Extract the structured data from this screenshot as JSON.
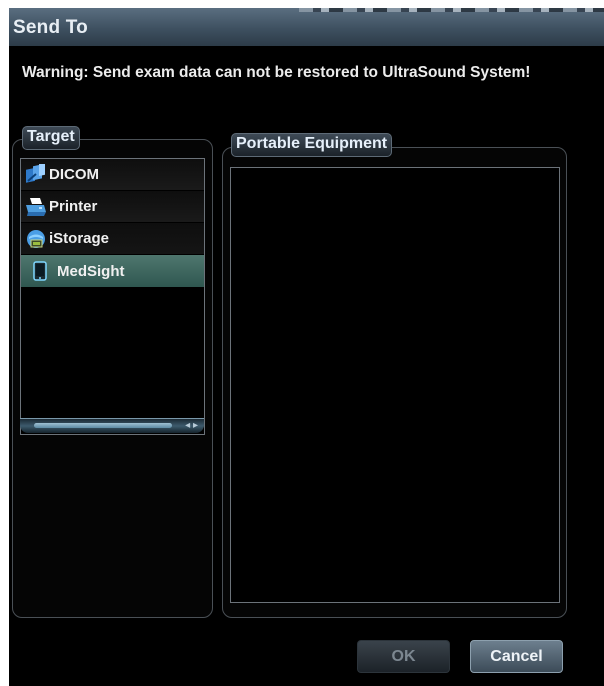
{
  "dialog": {
    "title": "Send To",
    "warning": "Warning: Send exam data can not be restored to UltraSound System!"
  },
  "target": {
    "label": "Target",
    "items": [
      {
        "label": "DICOM",
        "icon": "dicom-icon"
      },
      {
        "label": "Printer",
        "icon": "printer-icon"
      },
      {
        "label": "iStorage",
        "icon": "istorage-icon"
      },
      {
        "label": "MedSight",
        "icon": "tablet-icon",
        "selected": true
      }
    ]
  },
  "portable": {
    "label": "Portable Equipment",
    "items": []
  },
  "buttons": {
    "ok": "OK",
    "cancel": "Cancel"
  },
  "colors": {
    "selected_row": "#3f675f",
    "title_bar": "#3e5060",
    "background": "#000000"
  }
}
